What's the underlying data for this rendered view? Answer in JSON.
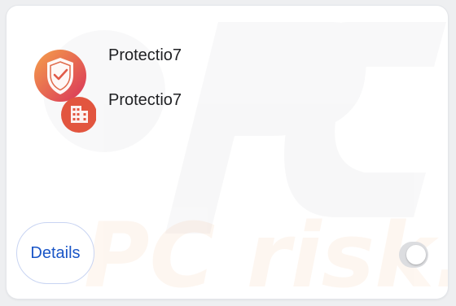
{
  "extension": {
    "name": "Protectio7",
    "description": "Protectio7",
    "icon": "shield-check-icon",
    "badge_icon": "building-icon",
    "enabled": false
  },
  "actions": {
    "details_label": "Details"
  },
  "watermark": {
    "text": "PC risk.com"
  },
  "colors": {
    "icon_gradient_start": "#f5a04a",
    "icon_gradient_end": "#d9335a",
    "badge": "#e2553f",
    "accent": "#1a56c7",
    "toggle_track": "#dcdde0"
  }
}
